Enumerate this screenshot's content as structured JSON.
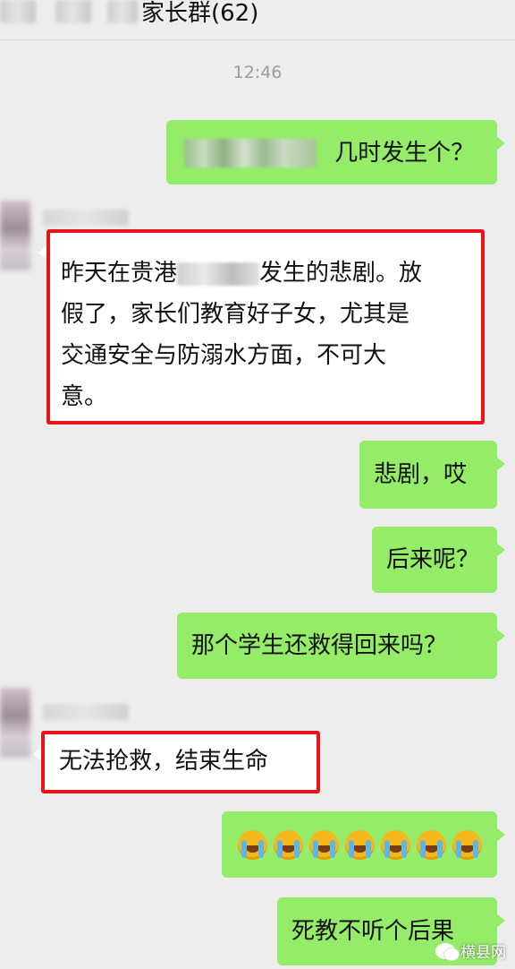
{
  "header": {
    "title": "家长群(62)"
  },
  "chat": {
    "time": "12:46",
    "messages": [
      {
        "from": "me",
        "text": "几时发生个？",
        "censored": true
      },
      {
        "from": "them",
        "lines": [
          "昨天在贵港",
          "发生的悲剧。放",
          "假了，家长们教育好子女，尤其是",
          "交通安全与防溺水方面，不可大",
          "意。"
        ],
        "highlighted": true
      },
      {
        "from": "me",
        "text": "悲剧，哎"
      },
      {
        "from": "me",
        "text": "后来呢？"
      },
      {
        "from": "me",
        "text": "那个学生还救得回来吗？"
      },
      {
        "from": "them",
        "text": "无法抢救，结束生命",
        "highlighted": true
      },
      {
        "from": "me",
        "emoji": "loudly-crying-face",
        "count": 7
      },
      {
        "from": "me",
        "text": "死教不听个后果"
      }
    ]
  },
  "watermark": {
    "text": "横县网"
  },
  "colors": {
    "me_bubble": "#95ec69",
    "them_bubble": "#ffffff",
    "highlight": "#e8141a",
    "background": "#ededed"
  }
}
